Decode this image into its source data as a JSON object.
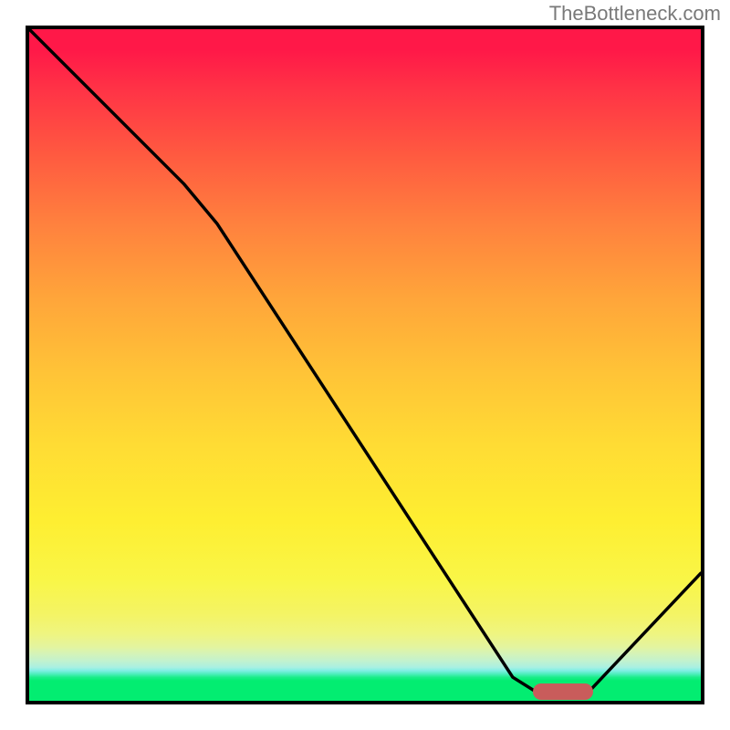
{
  "attribution": "TheBottleneck.com",
  "chart_data": {
    "type": "line",
    "title": "",
    "xlabel": "",
    "ylabel": "",
    "xlim": [
      0,
      100
    ],
    "ylim": [
      0,
      100
    ],
    "grid": false,
    "background_gradient": {
      "top_color": "#ff1848",
      "bottom_color": "#03ed71",
      "note": "smooth red→orange→yellow→green vertical gradient with green concentrated near bottom"
    },
    "curve_points": [
      {
        "x": 0,
        "y": 100
      },
      {
        "x": 23,
        "y": 77
      },
      {
        "x": 28,
        "y": 71
      },
      {
        "x": 72,
        "y": 3.5
      },
      {
        "x": 76,
        "y": 1
      },
      {
        "x": 83,
        "y": 1
      },
      {
        "x": 100,
        "y": 19
      }
    ],
    "marker": {
      "x_start": 75,
      "x_end": 84,
      "y": 1.3,
      "color": "#c95c5b",
      "shape": "pill"
    },
    "note": "Axes have no tick labels. Curve represents bottleneck percentage; minimum (optimal) region marked with pill."
  }
}
